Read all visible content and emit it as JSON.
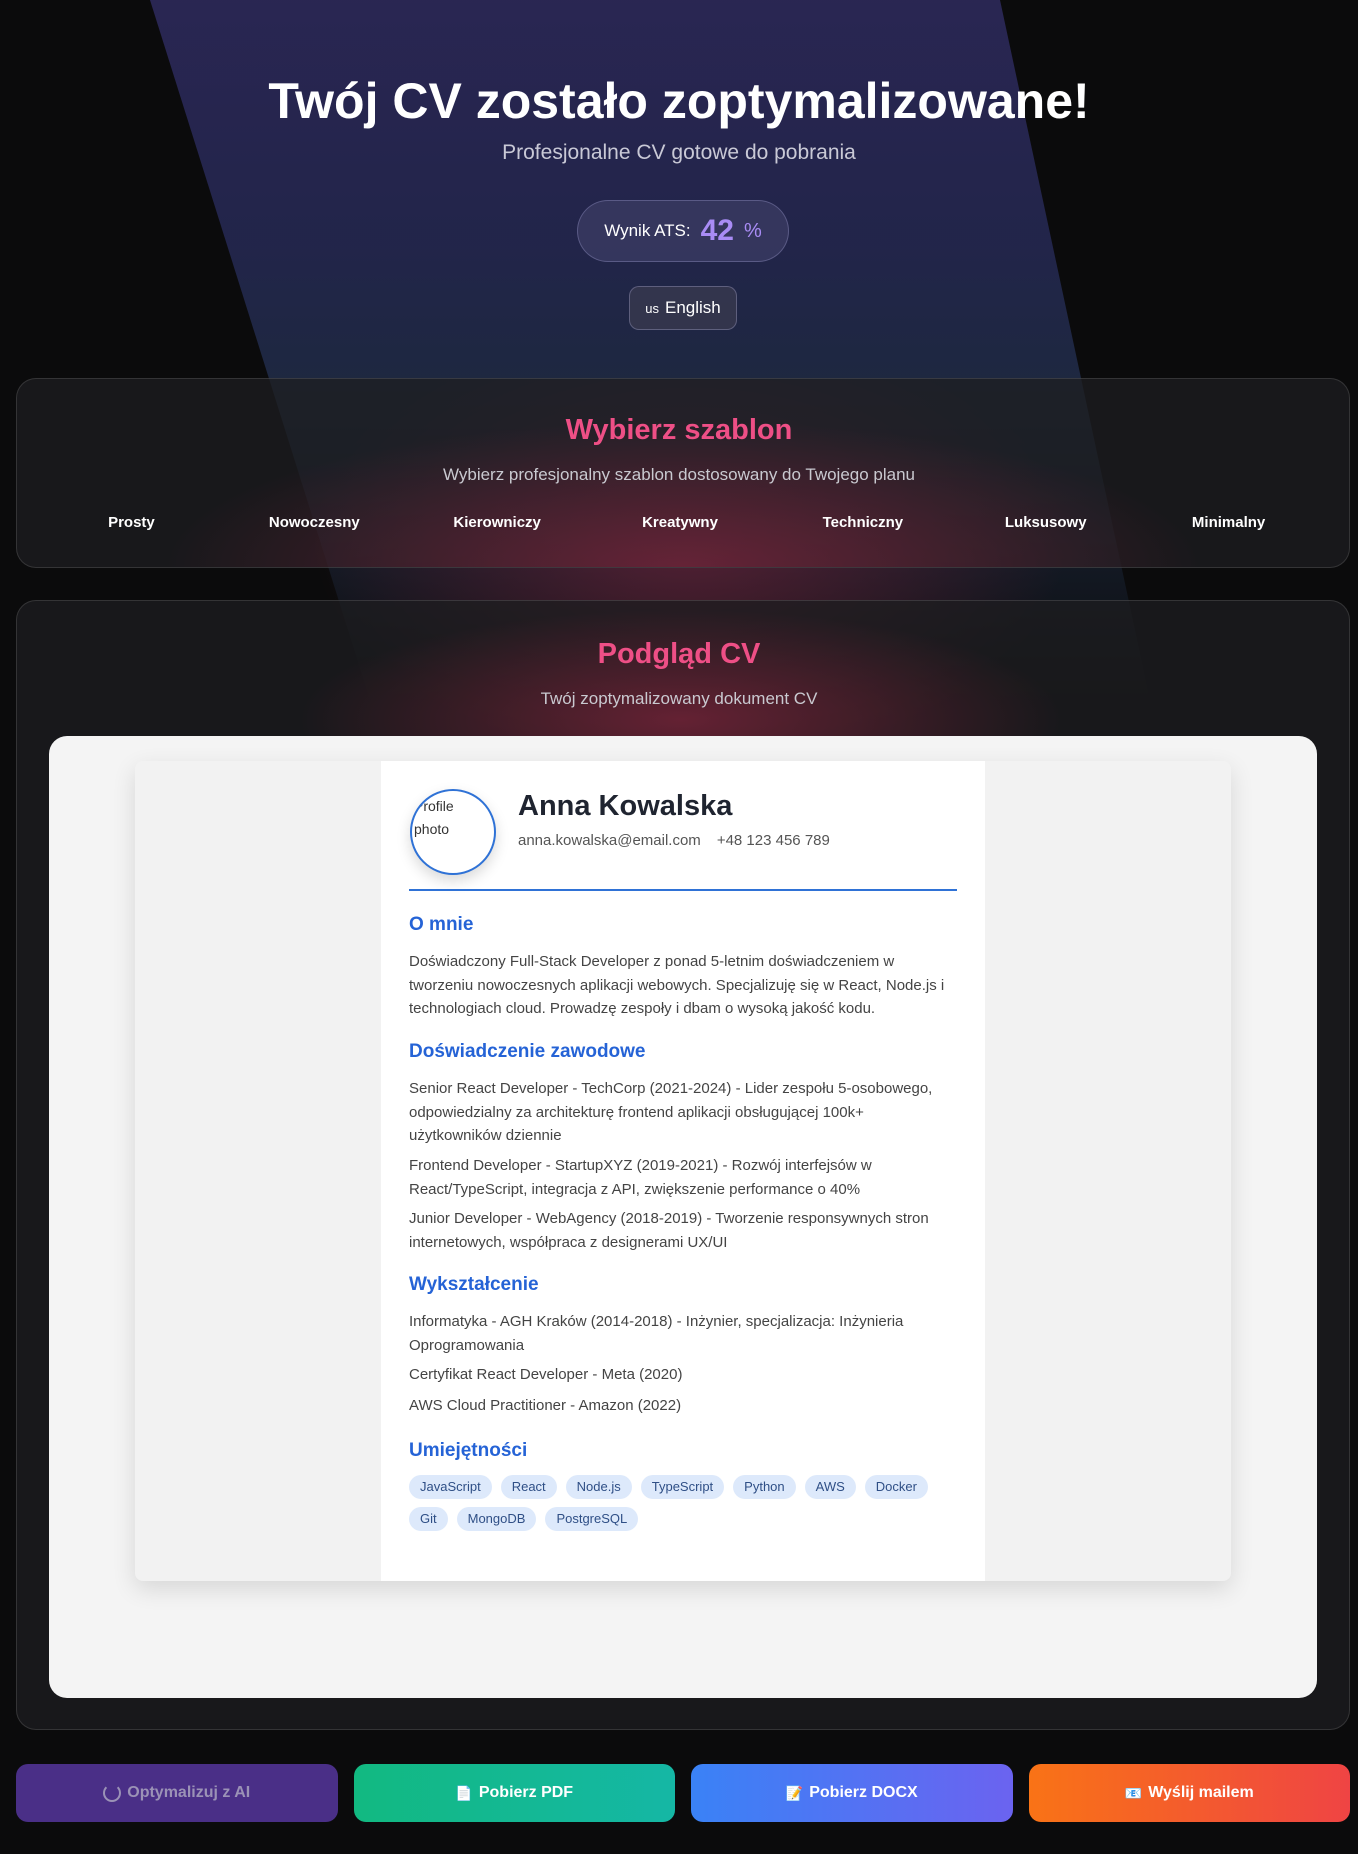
{
  "hero": {
    "title": "Twój CV zostało zoptymalizowane!",
    "subtitle": "Profesjonalne CV gotowe do pobrania",
    "ats_label": "Wynik ATS:",
    "ats_value": "42",
    "ats_unit": "%",
    "language_flag": "us",
    "language": "English"
  },
  "templates": {
    "title": "Wybierz szablon",
    "subtitle": "Wybierz profesjonalny szablon dostosowany do Twojego planu",
    "items": [
      "Prosty",
      "Nowoczesny",
      "Kierowniczy",
      "Kreatywny",
      "Techniczny",
      "Luksusowy",
      "Minimalny"
    ]
  },
  "preview": {
    "title": "Podgląd CV",
    "subtitle": "Twój zoptymalizowany dokument CV"
  },
  "cv": {
    "photo_alt": "Profile photo",
    "name": "Anna Kowalska",
    "email": "anna.kowalska@email.com",
    "phone": "+48 123 456 789",
    "about_title": "O mnie",
    "about": "Doświadczony Full-Stack Developer z ponad 5-letnim doświadczeniem w tworzeniu nowoczesnych aplikacji webowych. Specjalizuję się w React, Node.js i technologiach cloud. Prowadzę zespoły i dbam o wysoką jakość kodu.",
    "experience_title": "Doświadczenie zawodowe",
    "experience": [
      "Senior React Developer - TechCorp (2021-2024) - Lider zespołu 5-osobowego, odpowiedzialny za architekturę frontend aplikacji obsługującej 100k+ użytkowników dziennie",
      "Frontend Developer - StartupXYZ (2019-2021) - Rozwój interfejsów w React/TypeScript, integracja z API, zwiększenie performance o 40%",
      "Junior Developer - WebAgency (2018-2019) - Tworzenie responsywnych stron internetowych, współpraca z designerami UX/UI"
    ],
    "education_title": "Wykształcenie",
    "education": [
      "Informatyka - AGH Kraków (2014-2018) - Inżynier, specjalizacja: Inżynieria Oprogramowania",
      "Certyfikat React Developer - Meta (2020)",
      "AWS Cloud Practitioner - Amazon (2022)"
    ],
    "skills_title": "Umiejętności",
    "skills": [
      "JavaScript",
      "React",
      "Node.js",
      "TypeScript",
      "Python",
      "AWS",
      "Docker",
      "Git",
      "MongoDB",
      "PostgreSQL"
    ]
  },
  "actions": {
    "optimize": "Optymalizuj z AI",
    "pdf": "Pobierz PDF",
    "docx": "Pobierz DOCX",
    "email": "Wyślij mailem"
  },
  "colors": {
    "accent_pink": "#ee4f86",
    "cv_blue": "#2563d6",
    "ats_purple": "#a98cf5"
  }
}
